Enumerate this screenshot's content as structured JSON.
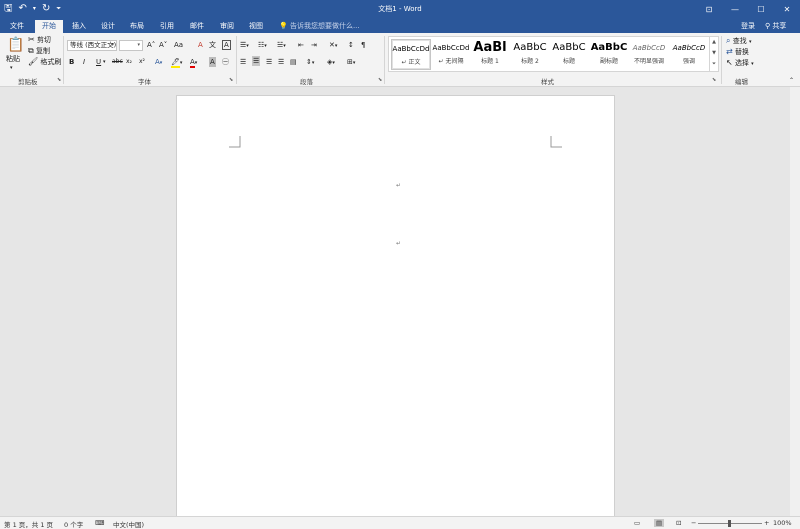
{
  "app": {
    "doc_title": "文档1 - Word"
  },
  "window_controls": {
    "ribbon_opts": "⊡",
    "minimize": "—",
    "maximize": "☐",
    "close": "✕"
  },
  "tabs": [
    {
      "label": "文件"
    },
    {
      "label": "开始"
    },
    {
      "label": "插入"
    },
    {
      "label": "设计"
    },
    {
      "label": "布局"
    },
    {
      "label": "引用"
    },
    {
      "label": "邮件"
    },
    {
      "label": "审阅"
    },
    {
      "label": "视图"
    }
  ],
  "tell_me": "告诉我您想要做什么...",
  "account": {
    "login": "登录",
    "share": "共享"
  },
  "clipboard": {
    "paste": "粘贴",
    "cut": "剪切",
    "copy": "复制",
    "format_painter": "格式刷",
    "group": "剪贴板"
  },
  "font": {
    "name": "等线 (西文正文)",
    "size": "",
    "group": "字体",
    "grow": "A˄",
    "shrink": "A˅",
    "case": "Aa",
    "clear": "A",
    "bold": "B",
    "italic": "I",
    "underline": "U",
    "strike": "abc",
    "sub": "x₂",
    "sup": "x²"
  },
  "paragraph": {
    "group": "段落"
  },
  "styles": {
    "group": "样式",
    "items": [
      {
        "sample": "AaBbCcDd",
        "name": "↵ 正文"
      },
      {
        "sample": "AaBbCcDd",
        "name": "↵ 无间隔"
      },
      {
        "sample": "AaBl",
        "name": "标题 1"
      },
      {
        "sample": "AaBbC",
        "name": "标题 2"
      },
      {
        "sample": "AaBbC",
        "name": "标题"
      },
      {
        "sample": "AaBbC",
        "name": "副标题"
      },
      {
        "sample": "AaBbCcD",
        "name": "不明显强调"
      },
      {
        "sample": "AaBbCcD",
        "name": "强调"
      }
    ]
  },
  "editing": {
    "find": "查找",
    "replace": "替换",
    "select": "选择",
    "group": "编辑"
  },
  "document": {
    "para_mark": "↵"
  },
  "status": {
    "page": "第 1 页，共 1 页",
    "words": "0 个字",
    "lang": "中文(中国)",
    "zoom": "100%",
    "zoom_minus": "−",
    "zoom_plus": "+"
  },
  "colors": {
    "brand": "#2b579a",
    "ribbon": "#f3f3f3",
    "canvas": "#e6e6e6"
  }
}
